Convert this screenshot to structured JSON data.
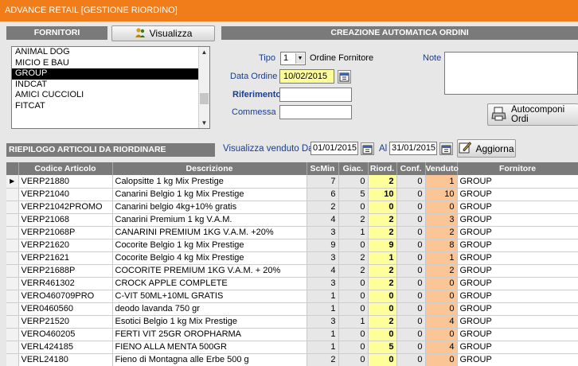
{
  "window": {
    "title": "ADVANCE RETAIL [GESTIONE RIORDINO]"
  },
  "fornitori": {
    "header": "FORNITORI",
    "visualizza_label": "Visualizza",
    "items": [
      {
        "label": "ANIMAL DOG",
        "selected": false
      },
      {
        "label": "MICIO E BAU",
        "selected": false
      },
      {
        "label": "GROUP",
        "selected": true
      },
      {
        "label": "INDCAT",
        "selected": false
      },
      {
        "label": "AMICI CUCCIOLI",
        "selected": false
      },
      {
        "label": "FITCAT",
        "selected": false
      }
    ]
  },
  "ordini": {
    "header": "CREAZIONE AUTOMATICA ORDINI",
    "tipo_label": "Tipo",
    "tipo_value": "1",
    "tipo_desc": "Ordine Fornitore",
    "note_label": "Note",
    "note_value": "",
    "data_label": "Data Ordine",
    "data_value": "10/02/2015",
    "riferimento_label": "Riferimento",
    "riferimento_value": "",
    "commessa_label": "Commessa",
    "commessa_value": "",
    "autocomponi_label": "Autocomponi Ordi"
  },
  "riepilogo": {
    "header": "RIEPILOGO ARTICOLI DA RIORDINARE",
    "venduto_label": "Visualizza venduto Dal",
    "dal_value": "01/01/2015",
    "al_label": "Al",
    "al_value": "31/01/2015",
    "aggiorna_label": "Aggiorna"
  },
  "table": {
    "columns": [
      "Codice Articolo",
      "Descrizione",
      "ScMin",
      "Giac.",
      "Riord.",
      "Conf.",
      "Venduto",
      "Fornitore"
    ],
    "rows": [
      [
        "VERP21880",
        "Calopsitte  1 kg Mix Prestige",
        "7",
        "0",
        "2",
        "0",
        "1",
        "GROUP"
      ],
      [
        "VERP21040",
        "Canarini Belgio 1 kg Mix Prestige",
        "6",
        "5",
        "10",
        "0",
        "10",
        "GROUP"
      ],
      [
        "VERP21042PROMO",
        "Canarini belgio 4kg+10% gratis",
        "2",
        "0",
        "0",
        "0",
        "0",
        "GROUP"
      ],
      [
        "VERP21068",
        "Canarini Premium 1 kg V.A.M.",
        "4",
        "2",
        "2",
        "0",
        "3",
        "GROUP"
      ],
      [
        "VERP21068P",
        "CANARINI PREMIUM 1KG V.A.M. +20%",
        "3",
        "1",
        "2",
        "0",
        "2",
        "GROUP"
      ],
      [
        "VERP21620",
        "Cocorite Belgio 1 kg Mix Prestige",
        "9",
        "0",
        "9",
        "0",
        "8",
        "GROUP"
      ],
      [
        "VERP21621",
        "Cocorite Belgio 4 kg Mix Prestige",
        "3",
        "2",
        "1",
        "0",
        "1",
        "GROUP"
      ],
      [
        "VERP21688P",
        "COCORITE PREMIUM 1KG V.A.M. + 20%",
        "4",
        "2",
        "2",
        "0",
        "2",
        "GROUP"
      ],
      [
        "VERR461302",
        "CROCK APPLE COMPLETE",
        "3",
        "0",
        "2",
        "0",
        "0",
        "GROUP"
      ],
      [
        "VERO460709PRO",
        "C-VIT 50ML+10ML GRATIS",
        "1",
        "0",
        "0",
        "0",
        "0",
        "GROUP"
      ],
      [
        "VER0460560",
        "deodo lavanda 750 gr",
        "1",
        "0",
        "0",
        "0",
        "0",
        "GROUP"
      ],
      [
        "VERP21520",
        "Esotici Belgio  1 kg Mix Prestige",
        "3",
        "1",
        "2",
        "0",
        "4",
        "GROUP"
      ],
      [
        "VERO460205",
        "FERTI VIT 25GR OROPHARMA",
        "1",
        "0",
        "0",
        "0",
        "0",
        "GROUP"
      ],
      [
        "VERL424185",
        "FIENO ALLA MENTA 500GR",
        "1",
        "0",
        "5",
        "0",
        "4",
        "GROUP"
      ],
      [
        "VERL24180",
        "Fieno di Montagna alle Erbe  500 g",
        "2",
        "0",
        "0",
        "0",
        "0",
        "GROUP"
      ]
    ]
  },
  "colors": {
    "accent": "#f07d1a",
    "header_gray": "#7a7a7a",
    "riord_yellow": "#ffff99",
    "venduto_orange": "#fbc596"
  }
}
